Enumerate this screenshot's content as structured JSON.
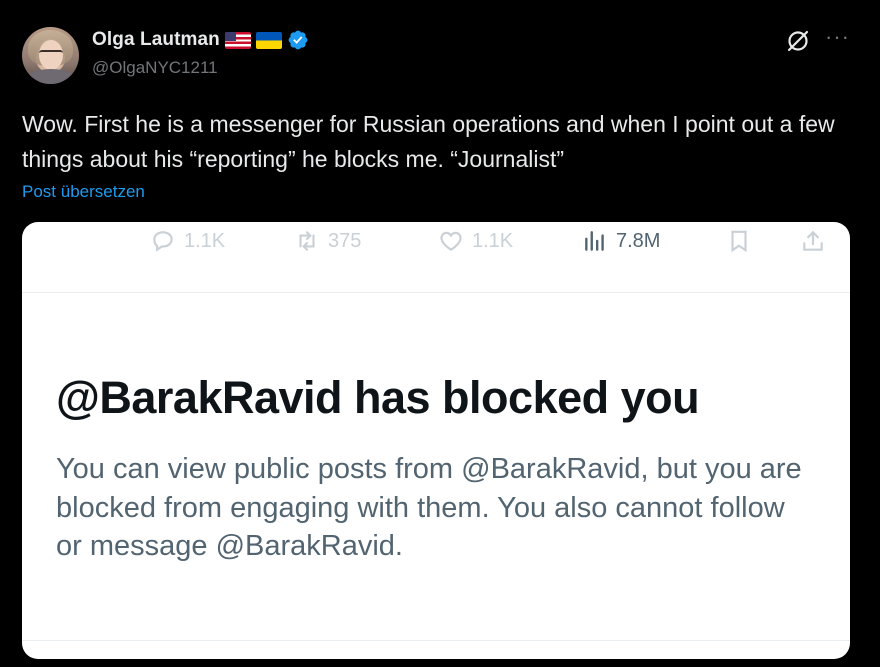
{
  "author": {
    "display_name": "Olga Lautman",
    "handle": "@OlgaNYC1211",
    "flags": [
      "us-flag",
      "ukraine-flag"
    ],
    "verified": true,
    "verified_color": "#1d9bf0"
  },
  "tweet": {
    "text": "Wow. First he is a messenger for Russian operations and when I point out a few things about his “reporting” he blocks me. “Journalist”",
    "translate_label": "Post übersetzen"
  },
  "media": {
    "actions": {
      "replies": "1.1K",
      "reposts": "375",
      "likes": "1.1K",
      "views": "7.8M"
    },
    "blocked_title": "@BarakRavid has blocked you",
    "blocked_body": "You can view public posts from @BarakRavid, but you are blocked from engaging with them. You also cannot follow or message @BarakRavid."
  },
  "colors": {
    "background": "#000000",
    "text_primary": "#e7e9ea",
    "text_secondary": "#71767b",
    "link": "#1d9bf0"
  },
  "icons": [
    "grok-icon",
    "more-icon",
    "reply-icon",
    "repost-icon",
    "like-icon",
    "views-icon",
    "bookmark-icon",
    "share-icon"
  ]
}
